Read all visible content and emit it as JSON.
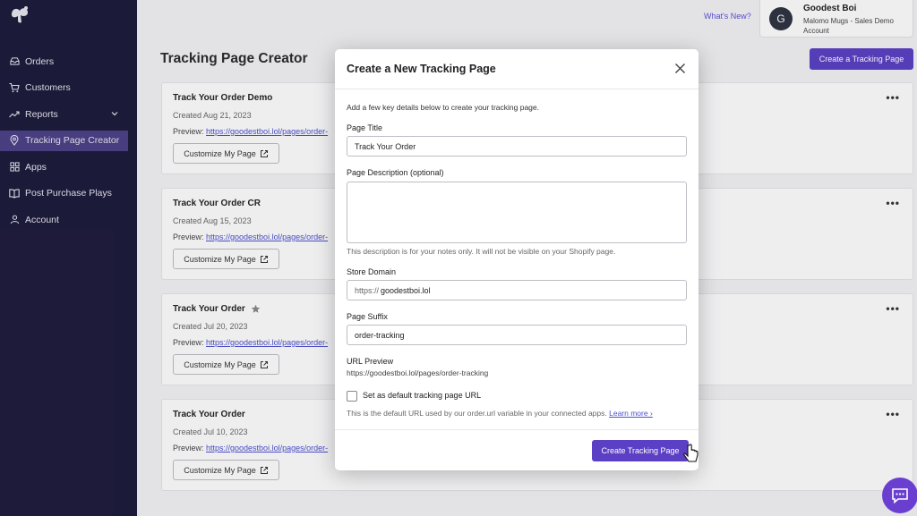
{
  "sidebar": {
    "items": [
      {
        "label": "Orders",
        "icon": "inbox-icon"
      },
      {
        "label": "Customers",
        "icon": "cart-icon"
      },
      {
        "label": "Reports",
        "icon": "trending-icon"
      },
      {
        "label": "Tracking Page Creator",
        "icon": "map-pin-icon"
      },
      {
        "label": "Apps",
        "icon": "grid-icon"
      },
      {
        "label": "Post Purchase Plays",
        "icon": "book-icon"
      },
      {
        "label": "Account",
        "icon": "user-icon"
      }
    ]
  },
  "header": {
    "whats_new": "What's New?",
    "avatar_letter": "G",
    "account_name": "Goodest Boi",
    "account_sub": "Malomo Mugs - Sales Demo Account"
  },
  "page": {
    "title": "Tracking Page Creator",
    "create_button": "Create a Tracking Page"
  },
  "cards": [
    {
      "title": "Track Your Order Demo",
      "date": "Created Aug 21, 2023",
      "preview_label": "Preview: ",
      "preview_link": "https://goodestboi.lol/pages/order-",
      "button": "Customize My Page",
      "starred": false
    },
    {
      "title": "Track Your Order CR",
      "date": "Created Aug 15, 2023",
      "preview_label": "Preview: ",
      "preview_link": "https://goodestboi.lol/pages/order-",
      "button": "Customize My Page",
      "starred": false
    },
    {
      "title": "Track Your Order",
      "date": "Created Jul 20, 2023",
      "preview_label": "Preview: ",
      "preview_link": "https://goodestboi.lol/pages/order-",
      "button": "Customize My Page",
      "starred": true
    },
    {
      "title": "Track Your Order",
      "date": "Created Jul 10, 2023",
      "preview_label": "Preview: ",
      "preview_link": "https://goodestboi.lol/pages/order-",
      "button": "Customize My Page",
      "starred": false
    }
  ],
  "modal": {
    "title": "Create a New Tracking Page",
    "intro": "Add a few key details below to create your tracking page.",
    "page_title_label": "Page Title",
    "page_title_value": "Track Your Order",
    "description_label": "Page Description (optional)",
    "description_value": "",
    "description_hint": "This description is for your notes only. It will not be visible on your Shopify page.",
    "store_domain_label": "Store Domain",
    "store_domain_prefix": "https://",
    "store_domain_value": "goodestboi.lol",
    "suffix_label": "Page Suffix",
    "suffix_value": "order-tracking",
    "url_preview_label": "URL Preview",
    "url_preview_value": "https://goodestboi.lol/pages/order-tracking",
    "default_checkbox_label": "Set as default tracking page URL",
    "default_checked": false,
    "default_hint": "This is the default URL used by our order.url variable in your connected apps.",
    "learn_more": "Learn more ›",
    "create_button": "Create Tracking Page"
  },
  "colors": {
    "sidebar_bg": "#1c1a3a",
    "sidebar_active": "#4b3f86",
    "accent": "#5b3fc4",
    "link": "#4b4fcf"
  }
}
